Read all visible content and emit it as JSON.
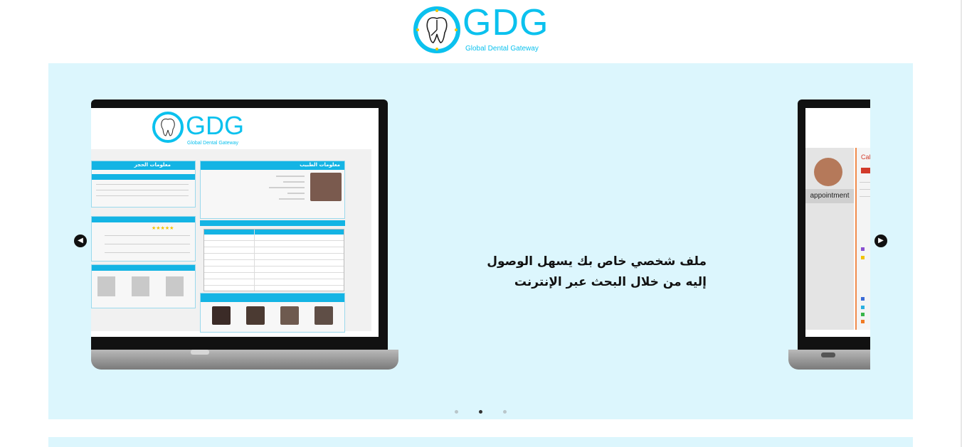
{
  "logo": {
    "brand": "GDG",
    "tagline": "Global Dental Gateway"
  },
  "slider": {
    "caption_line1": "ملف شخصي خاص بك يسهل الوصول",
    "caption_line2": "إليه من خلال البحث عبر الإنترنت",
    "prev_icon": "chevron-left-icon",
    "next_icon": "chevron-right-icon",
    "dots": 3,
    "active_dot": 2
  },
  "mock_screen": {
    "brand": "GDG",
    "tagline": "Global Dental Gateway",
    "doctor_panel_title": "معلومات الطبيب",
    "booking_panel_title": "معلومات الحجز"
  },
  "next_slide": {
    "avatar_label": "appointment",
    "calendar_label": "Cal"
  },
  "colors": {
    "accent": "#0bc1ee",
    "slider_bg": "#dcf6fd"
  }
}
